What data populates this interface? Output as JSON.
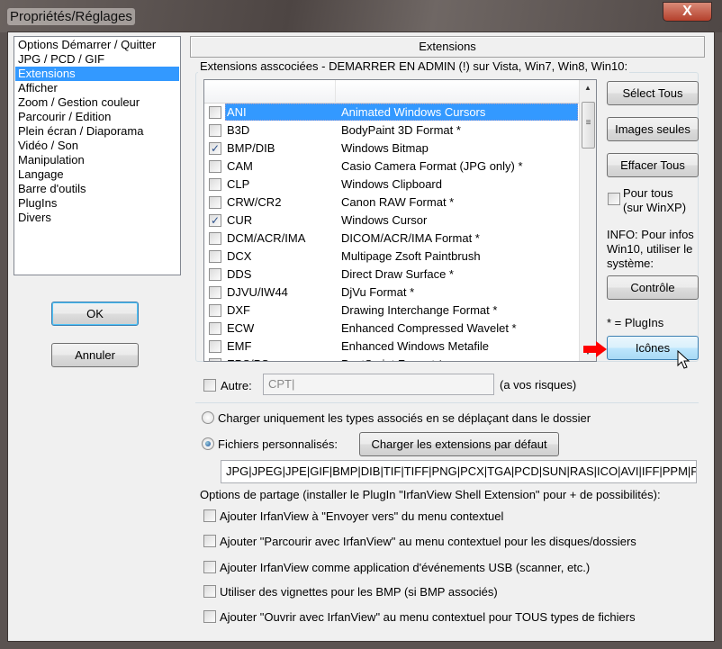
{
  "window": {
    "title": "Propriétés/Réglages",
    "close_label": "X"
  },
  "nav": {
    "items": [
      "Options Démarrer / Quitter",
      "JPG / PCD / GIF",
      "Extensions",
      "Afficher",
      "Zoom / Gestion couleur",
      "Parcourir / Edition",
      "Plein écran / Diaporama",
      "Vidéo / Son",
      "Manipulation",
      "Langage",
      "Barre d'outils",
      "PlugIns",
      "Divers"
    ],
    "selected": "Extensions"
  },
  "dialog": {
    "ok": "OK",
    "cancel": "Annuler"
  },
  "panel": {
    "header": "Extensions",
    "group_label": "Extensions asscociées - DEMARRER EN ADMIN (!) sur Vista, Win7, Win8, Win10:"
  },
  "extensions": [
    {
      "ext": "ANI",
      "desc": "Animated Windows Cursors",
      "checked": false,
      "selected": true
    },
    {
      "ext": "B3D",
      "desc": "BodyPaint 3D Format *",
      "checked": false
    },
    {
      "ext": "BMP/DIB",
      "desc": "Windows Bitmap",
      "checked": true
    },
    {
      "ext": "CAM",
      "desc": "Casio Camera Format (JPG only) *",
      "checked": false
    },
    {
      "ext": "CLP",
      "desc": "Windows Clipboard",
      "checked": false
    },
    {
      "ext": "CRW/CR2",
      "desc": "Canon RAW Format *",
      "checked": false
    },
    {
      "ext": "CUR",
      "desc": "Windows Cursor",
      "checked": true
    },
    {
      "ext": "DCM/ACR/IMA",
      "desc": "DICOM/ACR/IMA Format *",
      "checked": false
    },
    {
      "ext": "DCX",
      "desc": "Multipage Zsoft Paintbrush",
      "checked": false
    },
    {
      "ext": "DDS",
      "desc": "Direct Draw Surface *",
      "checked": false
    },
    {
      "ext": "DJVU/IW44",
      "desc": "DjVu Format *",
      "checked": false
    },
    {
      "ext": "DXF",
      "desc": "Drawing Interchange Format *",
      "checked": false
    },
    {
      "ext": "ECW",
      "desc": "Enhanced Compressed Wavelet *",
      "checked": false
    },
    {
      "ext": "EMF",
      "desc": "Enhanced Windows Metafile",
      "checked": false
    },
    {
      "ext": "EPS/PS",
      "desc": "PostScript Format *",
      "checked": true
    }
  ],
  "side": {
    "select_all": "Sélect Tous",
    "images_only": "Images seules",
    "clear_all": "Effacer Tous",
    "for_all": "Pour tous",
    "for_all_sub": "(sur WinXP)",
    "info": "INFO: Pour infos Win10, utiliser le système:",
    "control": "Contrôle",
    "plugins_note": "* = PlugIns",
    "icons": "Icônes"
  },
  "other": {
    "label": "Autre:",
    "value": "CPT|",
    "risk": "(a vos risques)",
    "checked": false
  },
  "load": {
    "radio1": "Charger uniquement les types associés en se déplaçant dans le dossier",
    "radio2": "Fichiers personnalisés:",
    "selected": "radio2",
    "default_button": "Charger les extensions par défaut",
    "custom_value": "JPG|JPEG|JPE|GIF|BMP|DIB|TIF|TIFF|PNG|PCX|TGA|PCD|SUN|RAS|ICO|AVI|IFF|PPM|PGM|PBM"
  },
  "share": {
    "label": "Options de partage (installer le PlugIn \"IrfanView Shell Extension\" pour + de possibilités):",
    "options": [
      "Ajouter IrfanView à \"Envoyer vers\" du menu contextuel",
      "Ajouter \"Parcourir avec IrfanView\" au menu contextuel pour les disques/dossiers",
      "Ajouter IrfanView comme application d'événements USB (scanner, etc.)",
      "Utiliser des vignettes pour les BMP (si BMP associés)",
      "Ajouter \"Ouvrir avec IrfanView\" au menu contextuel pour TOUS types de fichiers"
    ]
  },
  "colors": {
    "selection": "#3399ff",
    "accent_arrow": "#ff0000"
  }
}
